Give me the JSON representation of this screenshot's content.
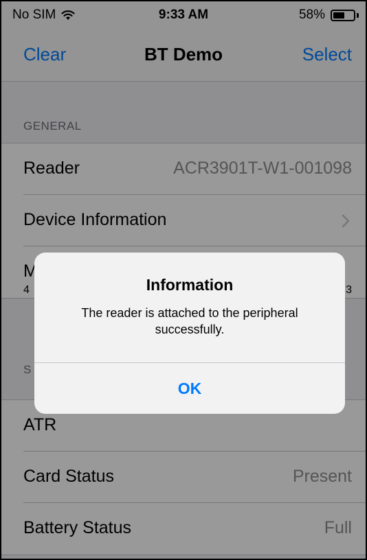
{
  "status_bar": {
    "carrier": "No SIM",
    "time": "9:33 AM",
    "battery_percent": "58%",
    "battery_level": 0.58,
    "wifi_icon": "wifi-icon",
    "battery_icon": "battery-icon"
  },
  "nav": {
    "left_label": "Clear",
    "title": "BT Demo",
    "right_label": "Select"
  },
  "general": {
    "header": "GENERAL",
    "rows": [
      {
        "label": "Reader",
        "value": "ACR3901T-W1-001098"
      },
      {
        "label": "Device Information",
        "value": ""
      },
      {
        "label": "M",
        "sub_left": "4",
        "sub_right": "3"
      }
    ]
  },
  "status_section": {
    "header_partial": "S",
    "rows": [
      {
        "label": "ATR",
        "value": ""
      },
      {
        "label": "Card Status",
        "value": "Present"
      },
      {
        "label": "Battery Status",
        "value": "Full"
      }
    ]
  },
  "alert": {
    "title": "Information",
    "message": "The reader is attached to the peripheral successfully.",
    "button_label": "OK"
  },
  "colors": {
    "accent": "#007aff",
    "secondary_text": "#8e8e93",
    "background": "#efeff4"
  }
}
